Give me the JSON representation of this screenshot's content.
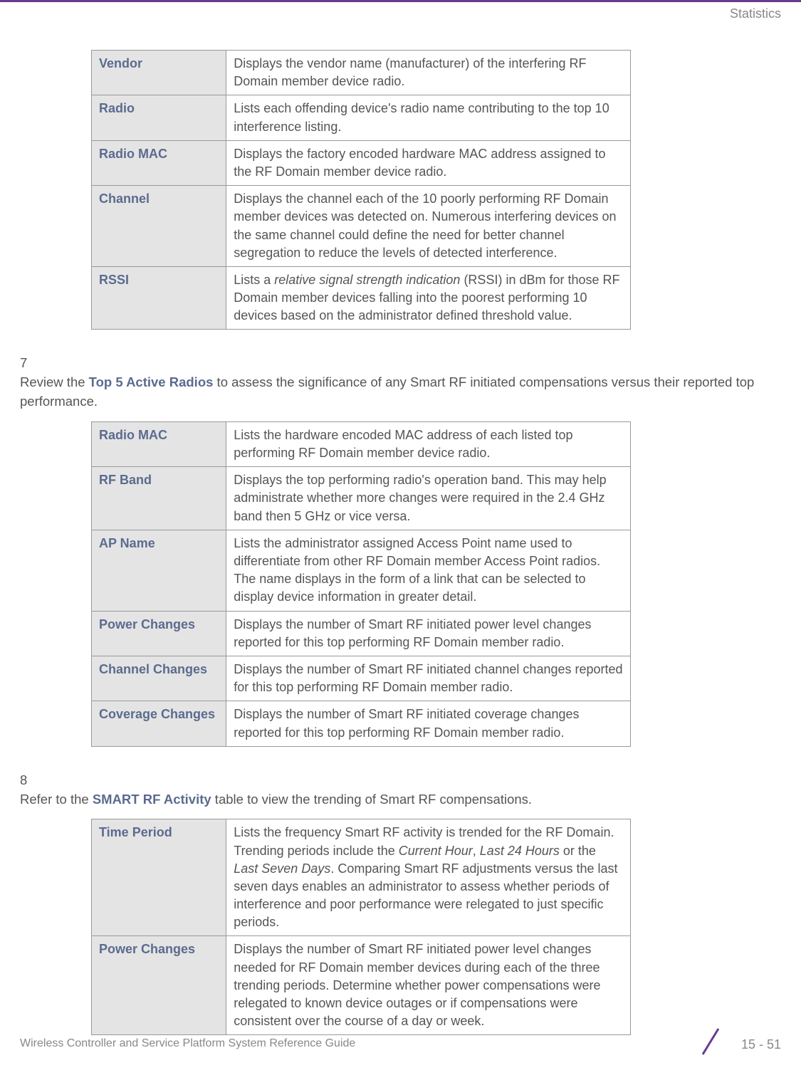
{
  "header": {
    "section": "Statistics"
  },
  "table1": {
    "rows": [
      {
        "term": "Vendor",
        "desc": "Displays the vendor name (manufacturer) of the interfering RF Domain member device radio."
      },
      {
        "term": "Radio",
        "desc": "Lists each offending device's radio name contributing to the top 10 interference listing."
      },
      {
        "term": "Radio MAC",
        "desc": "Displays the factory encoded hardware MAC address assigned to the RF Domain member device radio."
      },
      {
        "term": "Channel",
        "desc": "Displays the channel each of the 10 poorly performing RF Domain member devices was detected on. Numerous interfering devices on the same channel could define the need for better channel segregation to reduce the levels of detected interference."
      },
      {
        "term": "RSSI",
        "desc_pre": "Lists a ",
        "desc_em": "relative signal strength indication",
        "desc_post": " (RSSI) in dBm for those RF Domain member devices falling into the poorest performing 10 devices based on the administrator defined threshold value."
      }
    ]
  },
  "step7": {
    "num": "7",
    "pre": "Review the ",
    "bold": "Top 5 Active Radios",
    "post": " to assess the significance of any Smart RF initiated compensations versus their reported top performance."
  },
  "table2": {
    "rows": [
      {
        "term": "Radio MAC",
        "desc": "Lists the hardware encoded MAC address of each listed top performing RF Domain member device radio."
      },
      {
        "term": "RF Band",
        "desc": "Displays the top performing radio's operation band. This may help administrate whether more changes were required in the 2.4 GHz band then 5 GHz or vice versa."
      },
      {
        "term": "AP Name",
        "desc": "Lists the administrator assigned Access Point name used to differentiate from other RF Domain member Access Point radios. The name displays in the form of a link that can be selected to display device information in greater detail."
      },
      {
        "term": "Power Changes",
        "desc": "Displays the number of Smart RF initiated power level changes reported for this top performing RF Domain member radio."
      },
      {
        "term": "Channel Changes",
        "desc": "Displays the number of Smart RF initiated channel changes reported for this top performing RF Domain member radio."
      },
      {
        "term": "Coverage Changes",
        "desc": "Displays the number of Smart RF initiated coverage changes reported for this top performing RF Domain member radio."
      }
    ]
  },
  "step8": {
    "num": "8",
    "pre": "Refer to the ",
    "bold": "SMART RF Activity",
    "post": " table to view the trending of Smart RF compensations."
  },
  "table3": {
    "rows": [
      {
        "term": "Time Period",
        "desc_pre": "Lists the frequency Smart RF activity is trended for the RF Domain. Trending periods include the ",
        "em1": "Current Hour",
        "mid1": ", ",
        "em2": "Last 24 Hours",
        "mid2": " or the ",
        "em3": "Last Seven Days",
        "desc_post": ". Comparing Smart RF adjustments versus the last seven days enables an administrator to assess whether periods of interference and poor performance were relegated to just specific periods."
      },
      {
        "term": "Power Changes",
        "desc": "Displays the number of Smart RF initiated power level changes needed for RF Domain member devices during each of the three trending periods. Determine whether power compensations were relegated to known device outages or if compensations were consistent over the course of a day or week."
      }
    ]
  },
  "footer": {
    "title": "Wireless Controller and Service Platform System Reference Guide",
    "page": "15 - 51"
  }
}
